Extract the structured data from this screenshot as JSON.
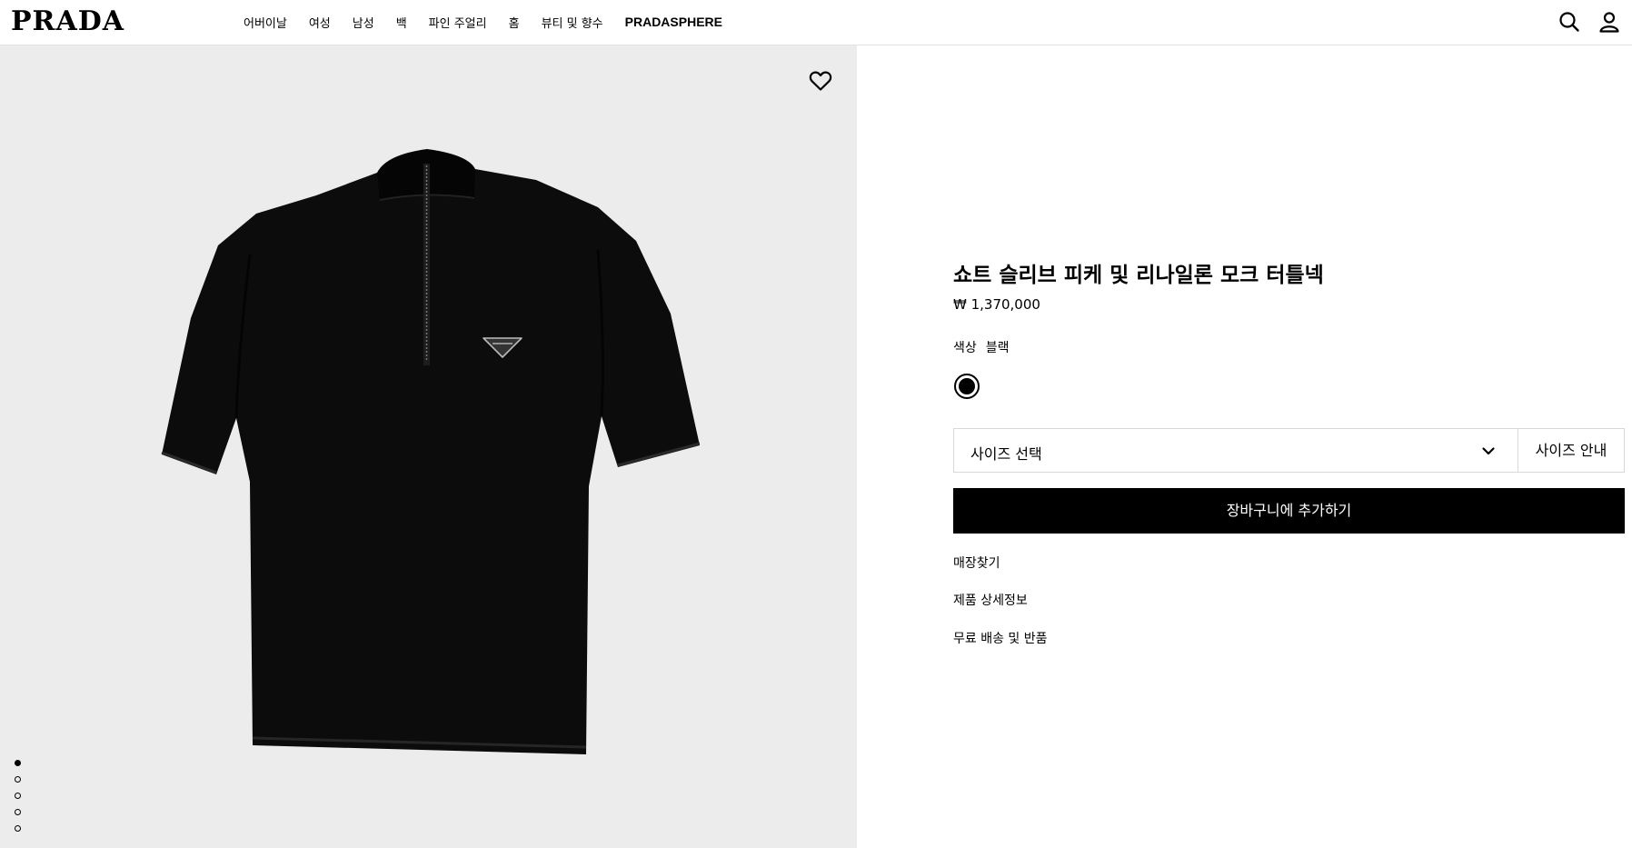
{
  "header": {
    "logo": "PRADA",
    "nav": [
      "어버이날",
      "여성",
      "남성",
      "백",
      "파인 주얼리",
      "홈",
      "뷰티 및 향수",
      "PRADASPHERE"
    ],
    "icons": [
      "search-icon",
      "account-icon"
    ]
  },
  "gallery": {
    "wishlist_icon": "heart-outline-icon",
    "slides_count": 5,
    "active_slide": 1
  },
  "product": {
    "title": "쇼트 슬리브 피케 및 리나일론 모크 터틀넥",
    "price": "₩ 1,370,000",
    "color_label": "색상",
    "color_value": "블랙",
    "size_select_label": "사이즈 선택",
    "size_guide_label": "사이즈 안내",
    "add_to_cart_label": "장바구니에 추가하기",
    "links": [
      "매장찾기",
      "제품 상세정보",
      "무료 배송 및 반품"
    ]
  },
  "colors": {
    "accent": "#000000",
    "image_bg": "#ececec",
    "border": "#d8d8d8"
  }
}
